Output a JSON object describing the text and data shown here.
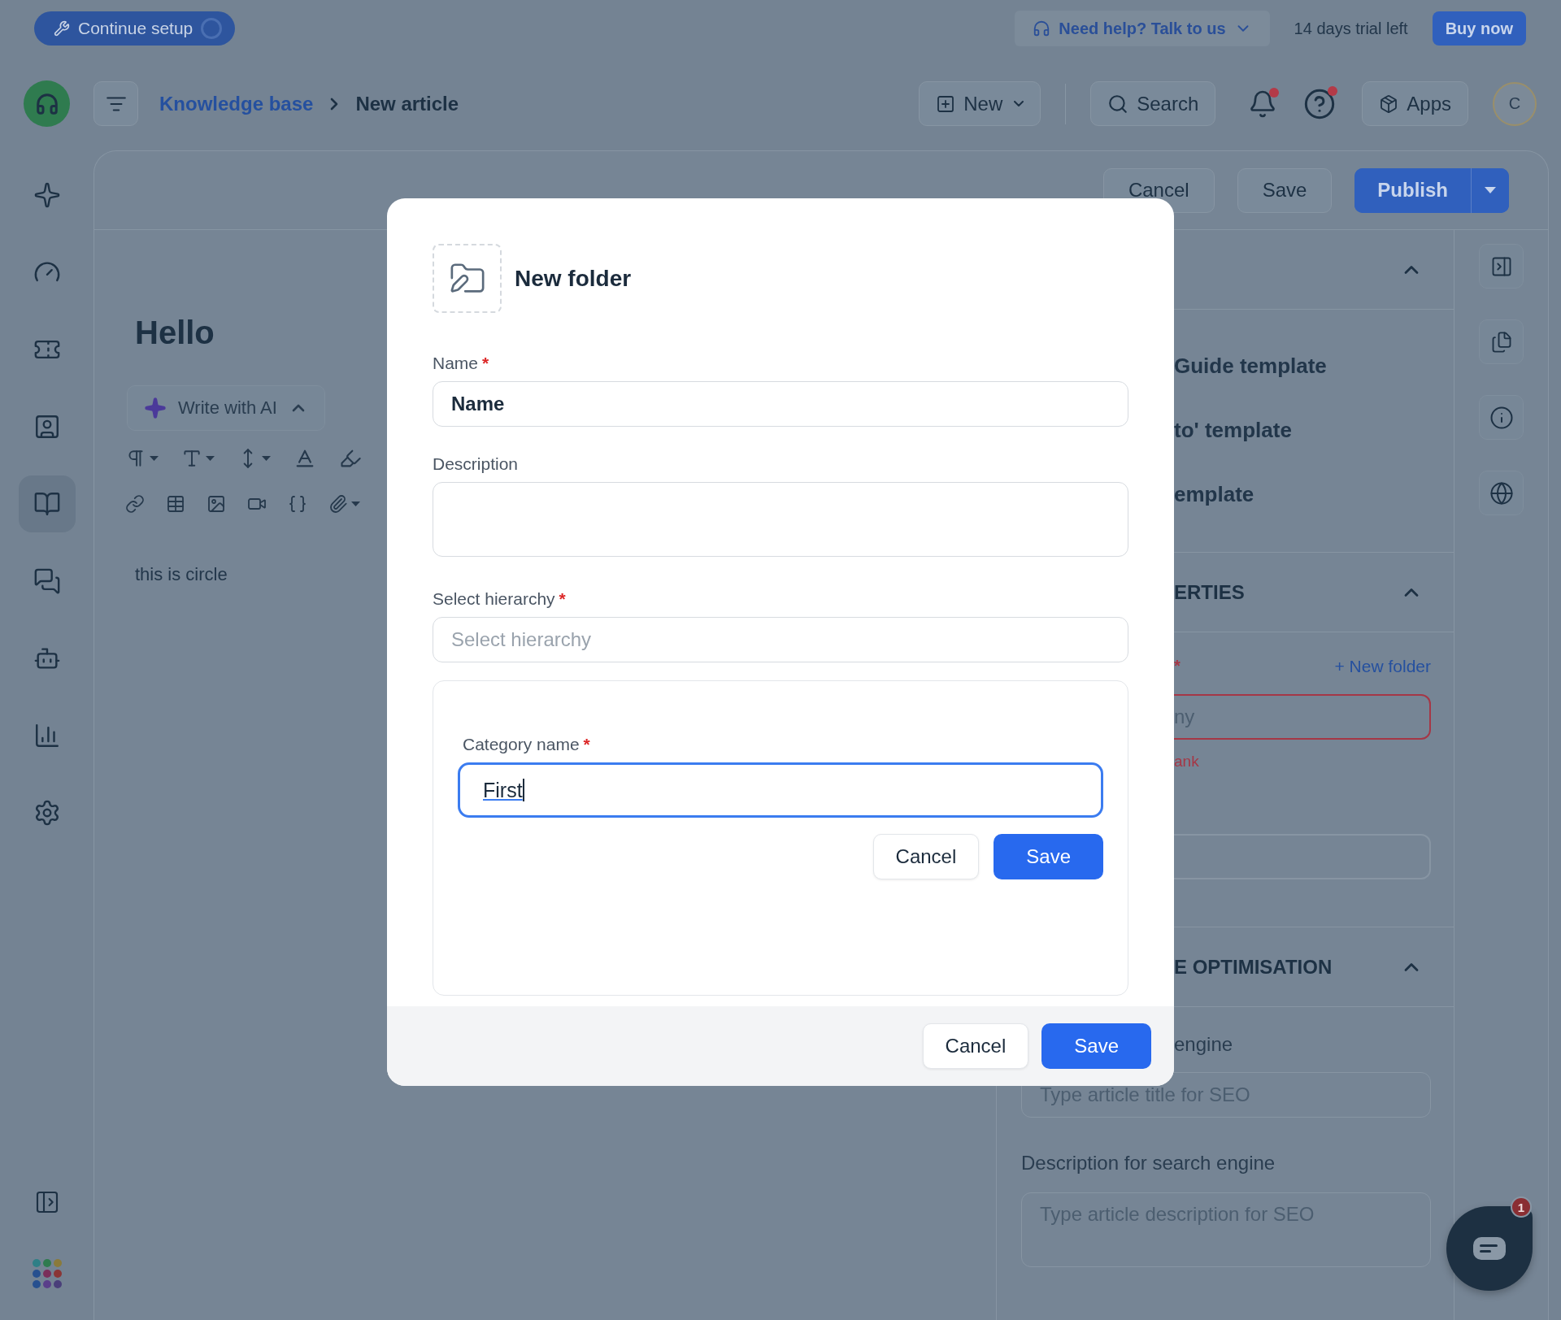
{
  "top_bar": {
    "setup_button": "Continue setup",
    "help_button": "Need help? Talk to us",
    "trial_text": "14 days trial left",
    "buy_button": "Buy now"
  },
  "header": {
    "breadcrumb": [
      {
        "label": "Knowledge base",
        "kind": "link"
      },
      {
        "label": "New article",
        "kind": "current"
      }
    ],
    "new_button": "New",
    "search_button": "Search",
    "notifications_unread": true,
    "help_unread": true,
    "apps_button": "Apps",
    "avatar": "C"
  },
  "sidebar": {
    "items": [
      {
        "selected": false
      },
      {
        "selected": false
      },
      {
        "selected": false
      },
      {
        "selected": false
      },
      {
        "selected": true
      },
      {
        "selected": false
      },
      {
        "selected": false
      },
      {
        "selected": false
      },
      {
        "selected": false
      }
    ]
  },
  "article_actions": {
    "cancel": "Cancel",
    "save": "Save",
    "publish": "Publish"
  },
  "editor": {
    "title": "Hello",
    "ai_button": "Write with AI",
    "body": "this is circle"
  },
  "right_panel": {
    "sections": [
      {
        "kind": "templates",
        "expanded": true,
        "items": [
          "Guide template",
          "to' template",
          "emplate"
        ]
      },
      {
        "kind": "properties",
        "heading": "ERTIES",
        "expanded": true,
        "required_mark": "*",
        "link": "+ New folder",
        "field_placeholder": "ny",
        "error": "ank"
      },
      {
        "kind": "seo",
        "heading": "E OPTIMISATION",
        "expanded": true,
        "title_label": "engine",
        "title_placeholder": "Type article title for SEO",
        "description_label": "Description for search engine",
        "description_placeholder": "Type article description for SEO"
      }
    ]
  },
  "chat": {
    "badge": "1"
  },
  "modal": {
    "title": "New folder",
    "required_mark": "*",
    "fields": [
      {
        "kind": "input",
        "label": "Name",
        "required": true,
        "value": "Name"
      },
      {
        "kind": "textarea",
        "label": "Description",
        "required": false
      },
      {
        "kind": "select",
        "label": "Select hierarchy",
        "required": true,
        "placeholder": "Select hierarchy"
      }
    ],
    "category": {
      "label": "Category name",
      "required": true,
      "value": "First",
      "focused": true,
      "cancel": "Cancel",
      "save": "Save"
    },
    "buttons": {
      "cancel": "Cancel",
      "save": "Save"
    }
  }
}
